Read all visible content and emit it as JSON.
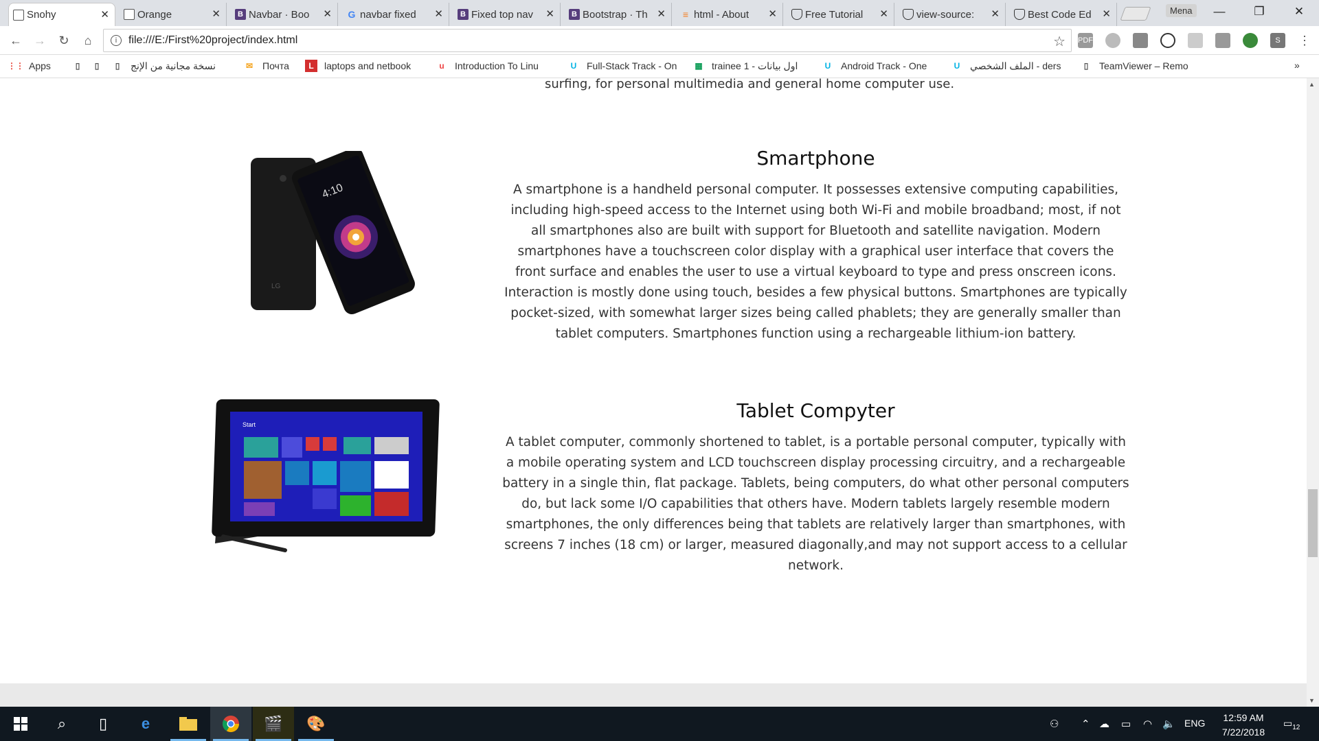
{
  "browser": {
    "tabs": [
      {
        "label": "Snohy",
        "icon": "page-icon",
        "color": "#ffffff",
        "active": true
      },
      {
        "label": "Orange",
        "icon": "page-icon",
        "color": "#ffffff",
        "active": false
      },
      {
        "label": "Navbar · Boo",
        "icon": "bootstrap-icon",
        "color": "#563d7c",
        "active": false
      },
      {
        "label": "navbar fixed",
        "icon": "google-icon",
        "color": "#4285f4",
        "active": false
      },
      {
        "label": "Fixed top nav",
        "icon": "bootstrap-icon",
        "color": "#563d7c",
        "active": false
      },
      {
        "label": "Bootstrap · Th",
        "icon": "bootstrap-icon",
        "color": "#563d7c",
        "active": false
      },
      {
        "label": "html - About",
        "icon": "stackoverflow-icon",
        "color": "#f48024",
        "active": false
      },
      {
        "label": "Free Tutorial",
        "icon": "shield-icon",
        "color": "#333333",
        "active": false
      },
      {
        "label": "view-source:",
        "icon": "shield-icon",
        "color": "#333333",
        "active": false
      },
      {
        "label": "Best Code Ed",
        "icon": "shield-icon",
        "color": "#333333",
        "active": false
      }
    ],
    "profile_name": "Mena",
    "url": "file:///E:/First%20project/index.html",
    "bookmarks": [
      {
        "label": "Apps",
        "icon": "apps-grid-icon"
      },
      {
        "label": "",
        "icon": "page-icon"
      },
      {
        "label": "",
        "icon": "page-icon"
      },
      {
        "label": "نسخة مجانية من الإنج",
        "icon": "page-icon"
      },
      {
        "label": "Почта",
        "icon": "mail-icon"
      },
      {
        "label": "laptops and netbook",
        "icon": "l-icon"
      },
      {
        "label": "Introduction To Linu",
        "icon": "udacity-icon"
      },
      {
        "label": "Full-Stack Track - On",
        "icon": "u-icon"
      },
      {
        "label": "trainee 1 - اول بيانات",
        "icon": "sheets-icon"
      },
      {
        "label": "Android Track - One",
        "icon": "u-icon"
      },
      {
        "label": "الملف الشخصي - ders",
        "icon": "u-icon"
      },
      {
        "label": "TeamViewer – Remo",
        "icon": "page-icon"
      }
    ],
    "bookmarks_overflow": "»"
  },
  "page": {
    "tail_text": "surfing, for personal multimedia and general home computer use.",
    "sections": [
      {
        "title": "Smartphone",
        "image": "smartphone-image",
        "text": "A smartphone is a handheld personal computer. It possesses extensive computing capabilities, including high-speed access to the Internet using both Wi-Fi and mobile broadband; most, if not all smartphones also are built with support for Bluetooth and satellite navigation. Modern smartphones have a touchscreen color display with a graphical user interface that covers the front surface and enables the user to use a virtual keyboard to type and press onscreen icons. Interaction is mostly done using touch, besides a few physical buttons. Smartphones are typically pocket-sized, with somewhat larger sizes being called phablets; they are generally smaller than tablet computers. Smartphones function using a rechargeable lithium-ion battery."
      },
      {
        "title": "Tablet Compyter",
        "image": "tablet-image",
        "text": "A tablet computer, commonly shortened to tablet, is a portable personal computer, typically with a mobile operating system and LCD touchscreen display processing circuitry, and a rechargeable battery in a single thin, flat package. Tablets, being computers, do what other personal computers do, but lack some I/O capabilities that others have. Modern tablets largely resemble modern smartphones, the only differences being that tablets are relatively larger than smartphones, with screens 7 inches (18 cm) or larger, measured diagonally,and may not support access to a cellular network."
      }
    ],
    "phone_time": "4:10",
    "phone_brand": "LG",
    "tablet_start": "Start"
  },
  "taskbar": {
    "language": "ENG",
    "time": "12:59 AM",
    "date": "7/22/2018",
    "notifications": "12"
  }
}
